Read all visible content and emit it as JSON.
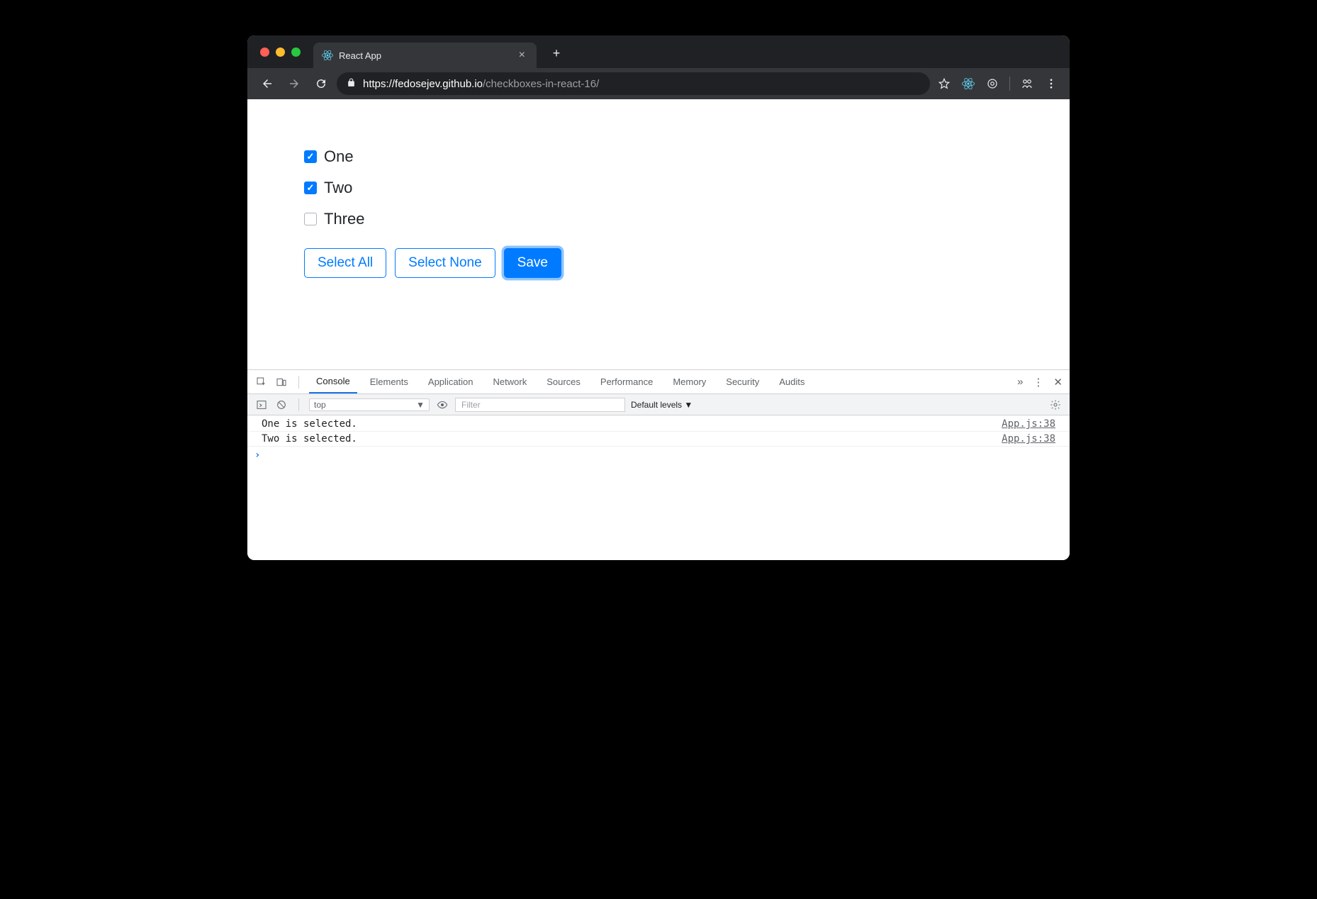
{
  "browser": {
    "tab_title": "React App",
    "url_host": "https://fedosejev.github.io",
    "url_path": "/checkboxes-in-react-16/"
  },
  "app": {
    "checkboxes": [
      {
        "label": "One",
        "checked": true
      },
      {
        "label": "Two",
        "checked": true
      },
      {
        "label": "Three",
        "checked": false
      }
    ],
    "buttons": {
      "select_all": "Select All",
      "select_none": "Select None",
      "save": "Save"
    }
  },
  "devtools": {
    "tabs": [
      "Console",
      "Elements",
      "Application",
      "Network",
      "Sources",
      "Performance",
      "Memory",
      "Security",
      "Audits"
    ],
    "active_tab": "Console",
    "toolbar": {
      "context": "top",
      "filter_placeholder": "Filter",
      "levels": "Default levels ▼"
    },
    "console": {
      "lines": [
        {
          "msg": "One is selected.",
          "src": "App.js:38"
        },
        {
          "msg": "Two is selected.",
          "src": "App.js:38"
        }
      ]
    }
  }
}
